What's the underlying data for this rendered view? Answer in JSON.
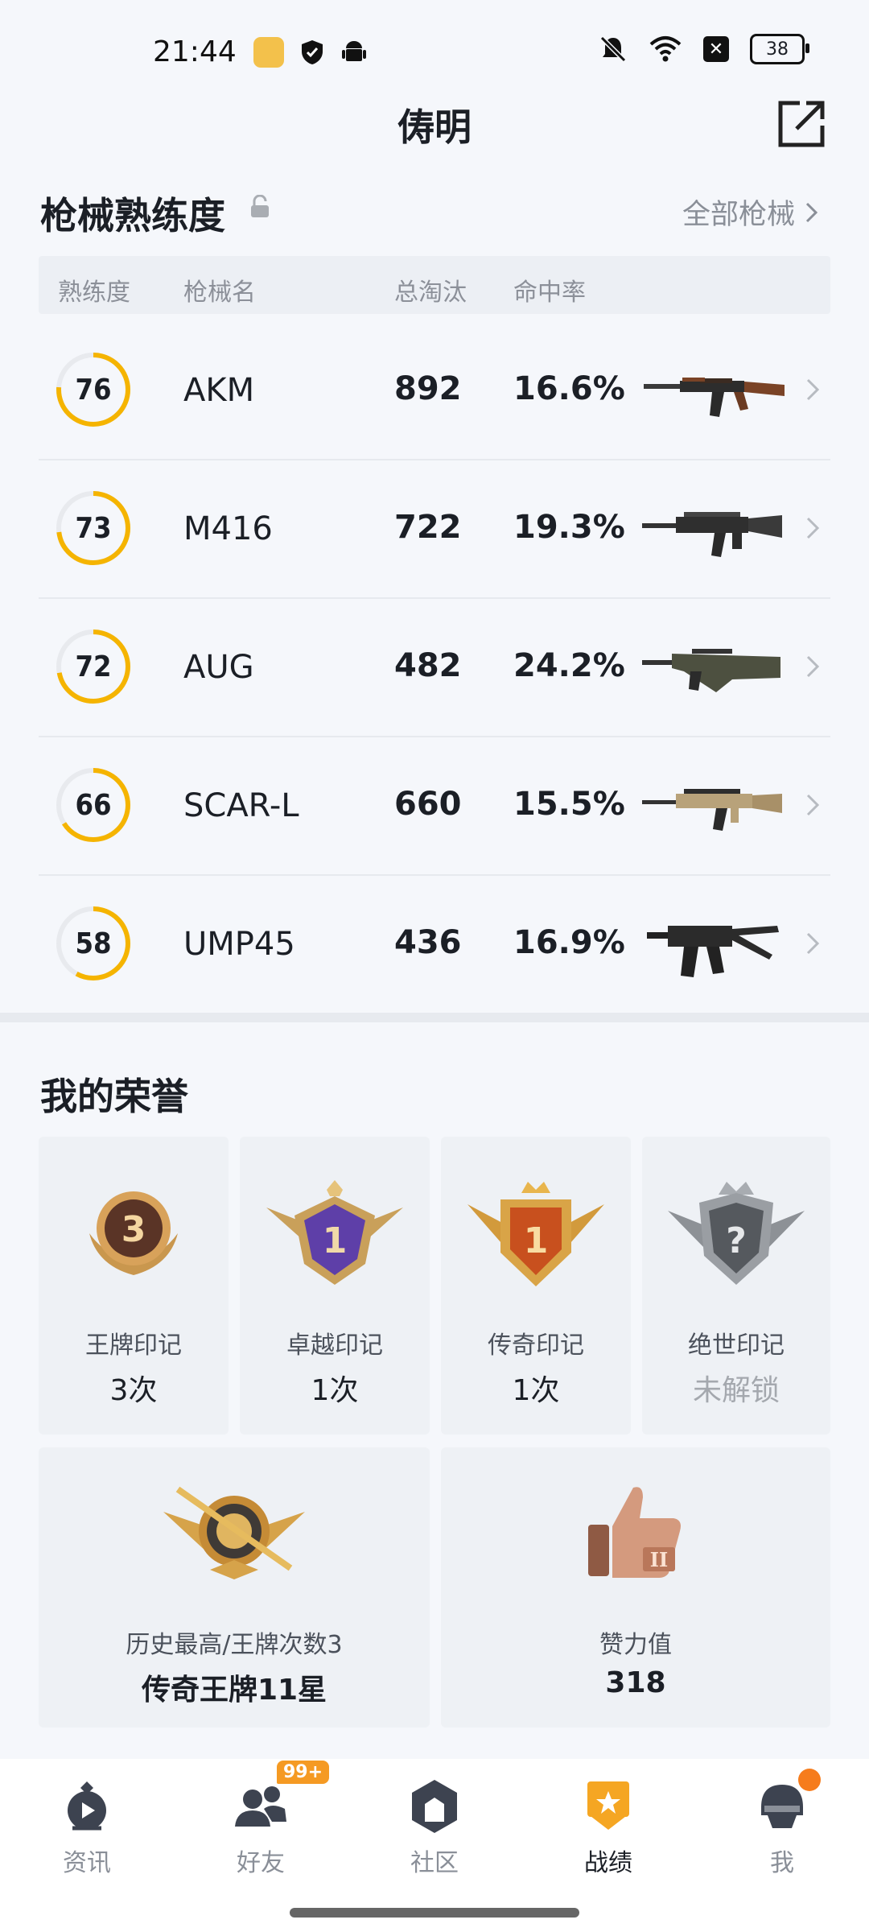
{
  "status_bar": {
    "time": "21:44",
    "battery": "38"
  },
  "header": {
    "title": "俦明"
  },
  "weapons": {
    "section_title": "枪械熟练度",
    "all_link": "全部枪械",
    "columns": [
      "熟练度",
      "枪械名",
      "总淘汰",
      "命中率"
    ],
    "rows": [
      {
        "proficiency": "76",
        "progress": 0.76,
        "name": "AKM",
        "kills": "892",
        "rate": "16.6%",
        "gun_icon": "akm-rifle-icon"
      },
      {
        "proficiency": "73",
        "progress": 0.73,
        "name": "M416",
        "kills": "722",
        "rate": "19.3%",
        "gun_icon": "m416-rifle-icon"
      },
      {
        "proficiency": "72",
        "progress": 0.72,
        "name": "AUG",
        "kills": "482",
        "rate": "24.2%",
        "gun_icon": "aug-rifle-icon"
      },
      {
        "proficiency": "66",
        "progress": 0.66,
        "name": "SCAR-L",
        "kills": "660",
        "rate": "15.5%",
        "gun_icon": "scar-rifle-icon"
      },
      {
        "proficiency": "58",
        "progress": 0.58,
        "name": "UMP45",
        "kills": "436",
        "rate": "16.9%",
        "gun_icon": "ump-smg-icon"
      }
    ]
  },
  "honors": {
    "section_title": "我的荣誉",
    "marks": [
      {
        "label": "王牌印记",
        "value": "3次",
        "badge_number": "3",
        "icon": "ace-mark-icon"
      },
      {
        "label": "卓越印记",
        "value": "1次",
        "badge_number": "1",
        "icon": "excellence-mark-icon"
      },
      {
        "label": "传奇印记",
        "value": "1次",
        "badge_number": "1",
        "icon": "legend-mark-icon"
      },
      {
        "label": "绝世印记",
        "value": "未解锁",
        "badge_number": "?",
        "icon": "peerless-mark-icon"
      }
    ],
    "highest": {
      "label": "历史最高/王牌次数3",
      "value": "传奇王牌11星",
      "icon": "ace-rank-emblem-icon"
    },
    "likes": {
      "label": "赞力值",
      "value": "318",
      "icon": "thumbs-up-icon"
    }
  },
  "bottom_nav": {
    "items": [
      {
        "label": "资讯",
        "icon": "news-play-icon"
      },
      {
        "label": "好友",
        "icon": "friends-icon",
        "badge": "99+"
      },
      {
        "label": "社区",
        "icon": "community-icon"
      },
      {
        "label": "战绩",
        "icon": "record-shield-icon",
        "active": true
      },
      {
        "label": "我",
        "icon": "profile-helmet-icon"
      }
    ]
  },
  "colors": {
    "accent": "#f5b400",
    "ring_track": "#e8eaee",
    "nav_active": "#f5a623"
  }
}
